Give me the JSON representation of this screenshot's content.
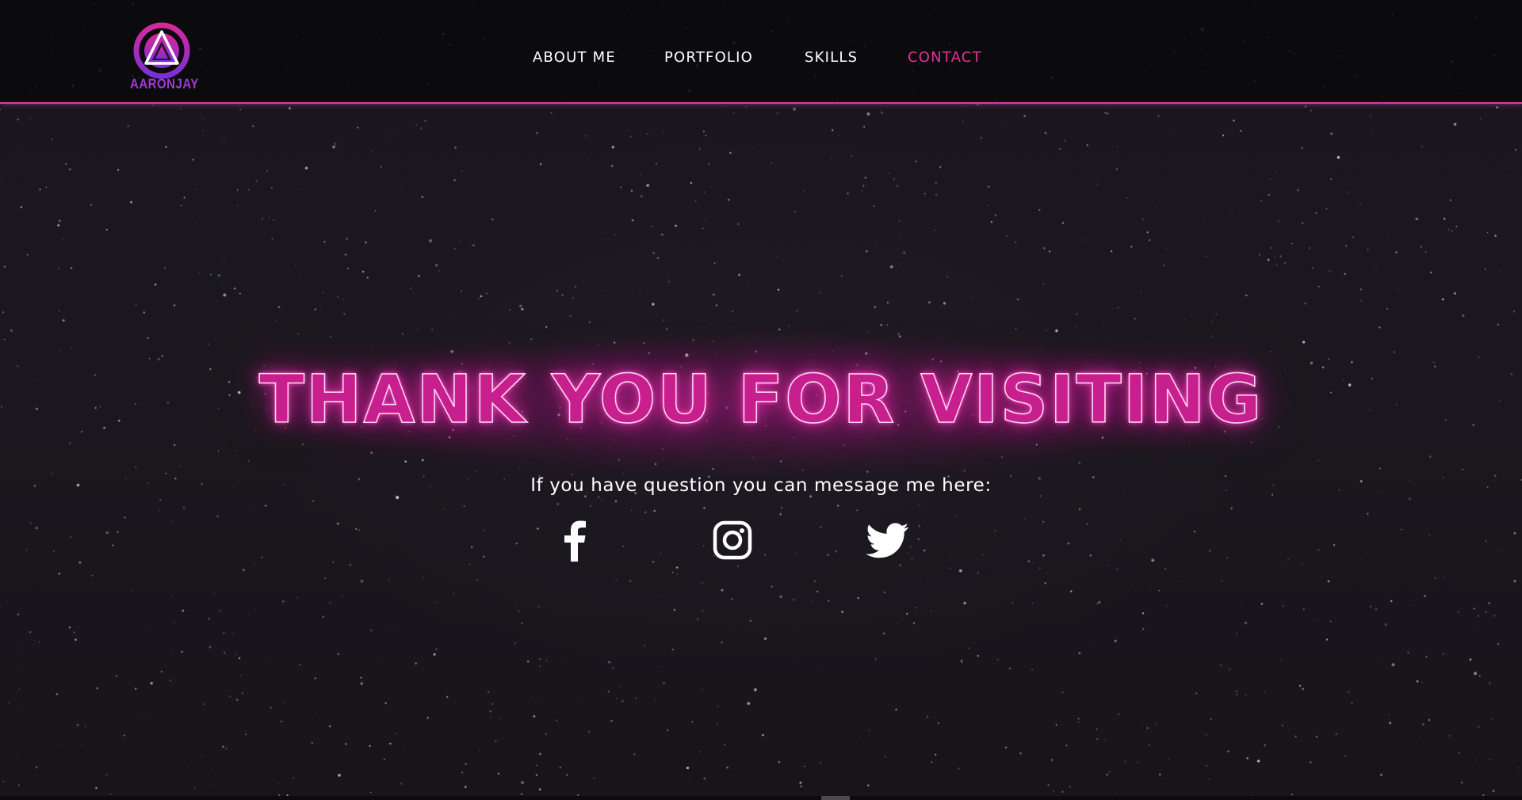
{
  "header": {
    "logo_text": "AARONJAY",
    "nav": [
      {
        "label": "ABOUT ME",
        "active": false
      },
      {
        "label": "PORTFOLIO",
        "active": false
      },
      {
        "label": "SKILLS",
        "active": false
      },
      {
        "label": "CONTACT",
        "active": true
      }
    ]
  },
  "hero": {
    "headline": "THANK YOU FOR VISITING",
    "subtext": "If you have question you can message me here:"
  },
  "social": [
    {
      "icon": "facebook-icon"
    },
    {
      "icon": "instagram-icon"
    },
    {
      "icon": "twitter-icon"
    }
  ],
  "colors": {
    "accent": "#e0339e",
    "headline_fill": "#c81f8e",
    "logo_gradient_top": "#d6299a",
    "logo_gradient_bottom": "#7b2fd6",
    "background": "#18161c",
    "header_border": "#d63aa8"
  }
}
